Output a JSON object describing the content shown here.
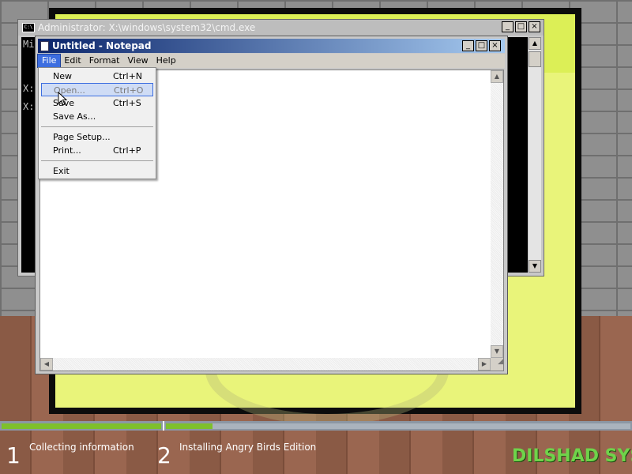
{
  "cmd": {
    "title": "Administrator: X:\\windows\\system32\\cmd.exe",
    "icon_label": "C:\\",
    "lines": [
      "Mi",
      "X:",
      "X:"
    ],
    "buttons": [
      "_",
      "□",
      "×"
    ]
  },
  "notepad": {
    "title": "Untitled - Notepad",
    "menu": [
      "File",
      "Edit",
      "Format",
      "View",
      "Help"
    ],
    "active_menu": "File",
    "buttons": [
      "_",
      "□",
      "×"
    ]
  },
  "file_menu": {
    "items": [
      {
        "label": "New",
        "shortcut": "Ctrl+N"
      },
      {
        "label": "Open...",
        "shortcut": "Ctrl+O"
      },
      {
        "label": "Save",
        "shortcut": "Ctrl+S"
      },
      {
        "label": "Save As...",
        "shortcut": ""
      },
      {
        "label": "Page Setup...",
        "shortcut": ""
      },
      {
        "label": "Print...",
        "shortcut": "Ctrl+P"
      },
      {
        "label": "Exit",
        "shortcut": ""
      }
    ],
    "highlighted": "Open..."
  },
  "setup": {
    "steps": [
      {
        "num": "1",
        "label": "Collecting information"
      },
      {
        "num": "2",
        "label": "Installing Angry Birds Edition"
      }
    ],
    "progress": {
      "step1": 1.0,
      "step2": 0.1
    }
  },
  "watermark": "DILSHAD SYS",
  "colors": {
    "frame_yellow": "#e9f47a",
    "progress_green": "#7ec02b",
    "title_blue": "#0a246a",
    "menu_highlight": "#3d6ee0"
  }
}
